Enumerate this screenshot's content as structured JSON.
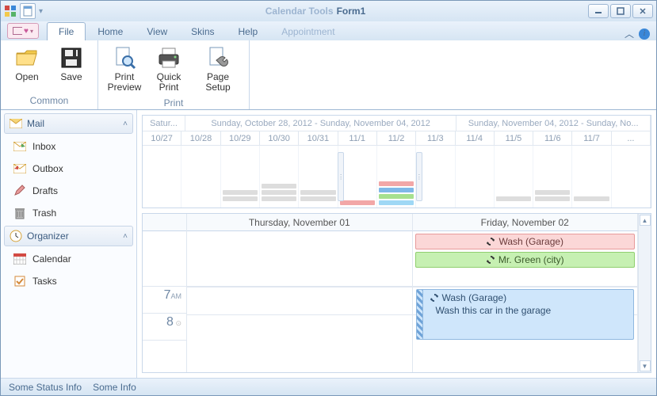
{
  "titlebar": {
    "tool_context": "Calendar Tools",
    "form_name": "Form1"
  },
  "ribbon": {
    "tabs": [
      "File",
      "Home",
      "View",
      "Skins",
      "Help",
      "Appointment"
    ],
    "active_tab": "File",
    "groups": {
      "common": {
        "label": "Common",
        "open": "Open",
        "save": "Save"
      },
      "print": {
        "label": "Print",
        "print_preview": "Print\nPreview",
        "quick_print": "Quick\nPrint",
        "page_setup": "Page Setup"
      }
    }
  },
  "sidebar": {
    "mail": {
      "header": "Mail",
      "items": [
        "Inbox",
        "Outbox",
        "Drafts",
        "Trash"
      ]
    },
    "organizer": {
      "header": "Organizer",
      "items": [
        "Calendar",
        "Tasks"
      ]
    }
  },
  "timeline": {
    "ranges": {
      "prev": "Satur...",
      "prev_w": 54,
      "current": "Sunday, October 28, 2012 - Sunday, November 04, 2012",
      "next": "Sunday, November 04, 2012 - Sunday, No..."
    },
    "days": [
      "10/27",
      "10/28",
      "10/29",
      "10/30",
      "10/31",
      "11/1",
      "11/2",
      "11/3",
      "11/4",
      "11/5",
      "11/6",
      "11/7",
      "..."
    ]
  },
  "dayview": {
    "headers": [
      "Thursday, November 01",
      "Friday, November 02"
    ],
    "allday": {
      "thursday": [],
      "friday": [
        {
          "label": "Wash (Garage)",
          "color": "pink",
          "recurring": true
        },
        {
          "label": "Mr. Green (city)",
          "color": "green",
          "recurring": true
        }
      ]
    },
    "hours": [
      {
        "h": "7",
        "ap": "AM"
      },
      {
        "h": "8",
        "ap": ""
      }
    ],
    "timed": {
      "friday": {
        "title": "Wash (Garage)",
        "desc": "Wash this car in the garage",
        "recurring": true
      }
    }
  },
  "statusbar": {
    "left": "Some Status Info",
    "right": "Some Info"
  }
}
